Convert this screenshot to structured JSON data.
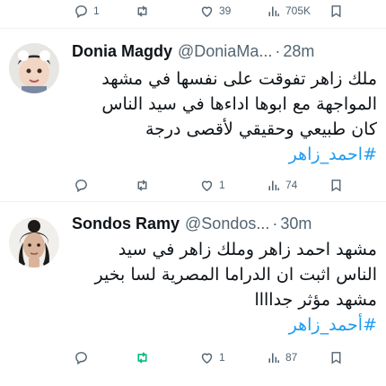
{
  "top_actions": {
    "reply_count": "1",
    "retweet_count": "",
    "like_count": "39",
    "view_count": "705K"
  },
  "tweets": [
    {
      "name": "Donia Magdy",
      "handle": "@DoniaMa...",
      "separator": "·",
      "time": "28m",
      "lines": [
        "ملك زاهر تفوقت على نفسها في مشهد",
        "المواجهة مع ابوها اداءها في سيد الناس",
        "كان طبيعي وحقيقي لأقصى درجة"
      ],
      "hashtag": "#احمد_زاهر",
      "actions": {
        "reply_count": "",
        "retweet_count": "",
        "like_count": "1",
        "view_count": "74"
      }
    },
    {
      "name": "Sondos Ramy",
      "handle": "@Sondos...",
      "separator": "·",
      "time": "30m",
      "lines": [
        "مشهد احمد زاهر وملك زاهر في سيد",
        "الناس اثبت ان الدراما المصرية لسا بخير",
        "مشهد مؤثر جداااا"
      ],
      "hashtag": "#أحمد_زاهر",
      "actions": {
        "reply_count": "",
        "retweet_count": "",
        "like_count": "1",
        "view_count": "87"
      }
    }
  ],
  "colors": {
    "text": "#0f1419",
    "secondary": "#536471",
    "link": "#1d9bf0",
    "retweet_active": "#00ba7c",
    "divider": "#eff3f4"
  }
}
